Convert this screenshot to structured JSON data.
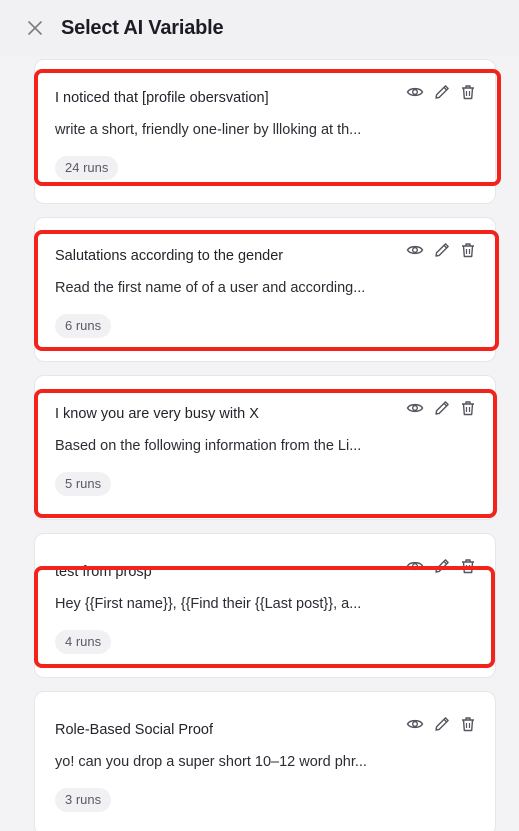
{
  "header": {
    "title": "Select AI Variable",
    "close_icon": "close-icon"
  },
  "variables": [
    {
      "name": "I noticed that [profile obersvation]",
      "prompt": "write a short, friendly one-liner by llloking at th...",
      "runs": "24 runs"
    },
    {
      "name": "Salutations according to the gender",
      "prompt": "Read the first name of of a user and according...",
      "runs": "6 runs"
    },
    {
      "name": "I know you are very busy with X",
      "prompt": "Based on the following information from the Li...",
      "runs": "5 runs"
    },
    {
      "name": "test from prosp",
      "prompt": "Hey {{First name}}, {{Find their {{Last post}}, a...",
      "runs": "4 runs"
    },
    {
      "name": "Role-Based Social Proof",
      "prompt": "yo! can you drop a super short 10–12 word phr...",
      "runs": "3 runs"
    }
  ],
  "icons": {
    "view": "eye-icon",
    "edit": "pencil-icon",
    "delete": "trash-icon"
  },
  "colors": {
    "annotation_red": "#f2231b",
    "title_text": "#1c1c26",
    "runs_badge_bg": "#f1f1f4"
  }
}
